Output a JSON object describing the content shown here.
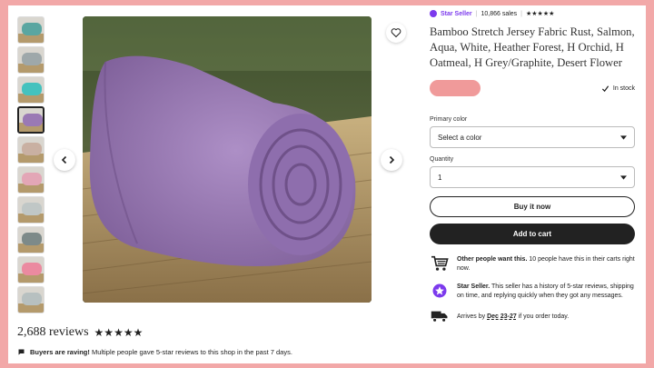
{
  "thumbnails": [
    {
      "color": "#5aa6a1"
    },
    {
      "color": "#9ea8aa"
    },
    {
      "color": "#44c2be"
    },
    {
      "color": "#9a79b4"
    },
    {
      "color": "#c9b0a2"
    },
    {
      "color": "#e3a6b6"
    },
    {
      "color": "#c0c7c6"
    },
    {
      "color": "#7d8a89"
    },
    {
      "color": "#eb8aa0"
    },
    {
      "color": "#b7c0c0"
    }
  ],
  "image": {
    "fabric_color": "#9a79b4",
    "prev_icon": "chevron-left-icon",
    "next_icon": "chevron-right-icon",
    "favorite_icon": "heart-icon"
  },
  "reviews": {
    "count": "2,688 reviews",
    "stars": "★★★★★"
  },
  "raving": {
    "bold": "Buyers are raving!",
    "text": " Multiple people gave 5-star reviews to this shop in the past 7 days."
  },
  "seller": {
    "badge": "Star Seller",
    "sales": "10,866 sales",
    "stars": "★★★★★"
  },
  "product": {
    "title": "Bamboo Stretch Jersey Fabric Rust, Salmon, Aqua, White, Heather Forest, H Orchid, H Oatmeal, H Grey/Graphite, Desert Flower",
    "stock": "In stock"
  },
  "options": {
    "color_label": "Primary color",
    "color_value": "Select a color",
    "qty_label": "Quantity",
    "qty_value": "1"
  },
  "buttons": {
    "buy_now": "Buy it now",
    "add_to_cart": "Add to cart"
  },
  "info": {
    "want_bold": "Other people want this.",
    "want_text": " 10 people have this in their carts right now.",
    "star_bold": "Star Seller.",
    "star_text": " This seller has a history of 5-star reviews, shipping on time, and replying quickly when they got any messages.",
    "arrives_pre": "Arrives by ",
    "arrives_date": "Dec 23-27",
    "arrives_post": " if you order today."
  },
  "colors": {
    "accent_purple": "#7c3aed",
    "price_pill": "#f09a9a",
    "border": "#f2a8a8"
  }
}
